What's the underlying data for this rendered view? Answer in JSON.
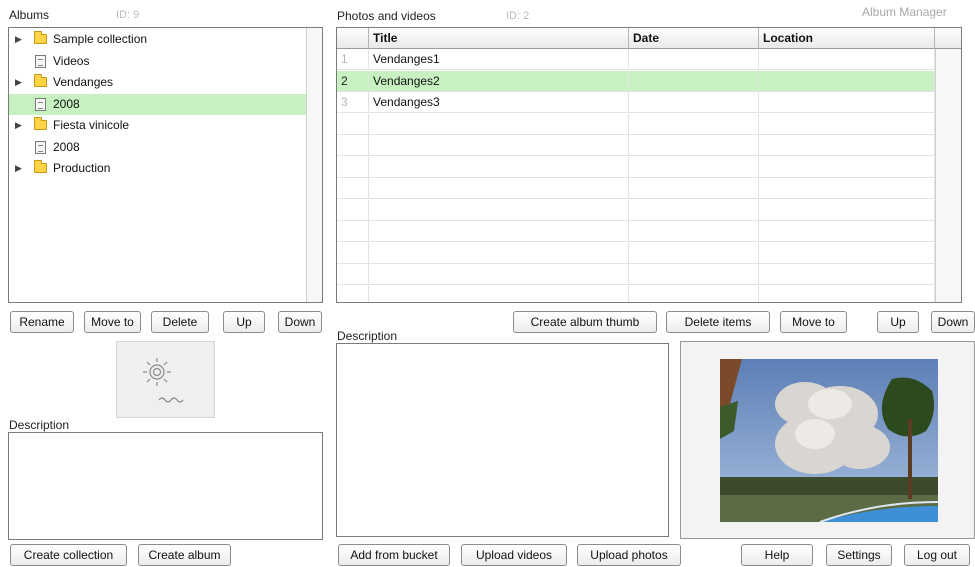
{
  "header": {
    "albums_label": "Albums",
    "albums_id": "ID: 9",
    "photos_label": "Photos and videos",
    "photos_id": "ID: 2",
    "app_title": "Album Manager"
  },
  "albums": {
    "items": [
      {
        "label": "Sample collection",
        "type": "collection",
        "expandable": true,
        "selected": false
      },
      {
        "label": "Videos",
        "type": "album",
        "expandable": false,
        "selected": false
      },
      {
        "label": "Vendanges",
        "type": "collection",
        "expandable": true,
        "selected": false
      },
      {
        "label": "2008",
        "type": "album",
        "expandable": false,
        "selected": true
      },
      {
        "label": "Fiesta vinicole",
        "type": "collection",
        "expandable": true,
        "selected": false
      },
      {
        "label": "2008",
        "type": "album",
        "expandable": false,
        "selected": false
      },
      {
        "label": "Production",
        "type": "collection",
        "expandable": true,
        "selected": false
      }
    ],
    "buttons": {
      "rename": "Rename",
      "move_to": "Move to",
      "delete": "Delete",
      "up": "Up",
      "down": "Down"
    },
    "description_label": "Description",
    "description_value": "",
    "create_collection": "Create collection",
    "create_album": "Create album"
  },
  "photos": {
    "columns": [
      "Title",
      "Date",
      "Location"
    ],
    "rows": [
      {
        "num": "1",
        "title": "Vendanges1",
        "date": "",
        "location": "",
        "selected": false
      },
      {
        "num": "2",
        "title": "Vendanges2",
        "date": "",
        "location": "",
        "selected": true
      },
      {
        "num": "3",
        "title": "Vendanges3",
        "date": "",
        "location": "",
        "selected": false
      }
    ],
    "buttons": {
      "create_album_thumb": "Create album thumb",
      "delete_items": "Delete items",
      "move_to": "Move to",
      "up": "Up",
      "down": "Down"
    },
    "description_label": "Description",
    "description_value": "",
    "add_from_bucket": "Add from bucket",
    "upload_videos": "Upload videos",
    "upload_photos": "Upload photos"
  },
  "footer": {
    "help": "Help",
    "settings": "Settings",
    "log_out": "Log out"
  },
  "icons": {
    "collection": "folder-icon",
    "album": "album-icon",
    "expand": "triangle-right-icon",
    "media": "photo-thumbnail-icon"
  },
  "colors": {
    "selection": "#c7f1c1",
    "folder": "#ffd447"
  }
}
